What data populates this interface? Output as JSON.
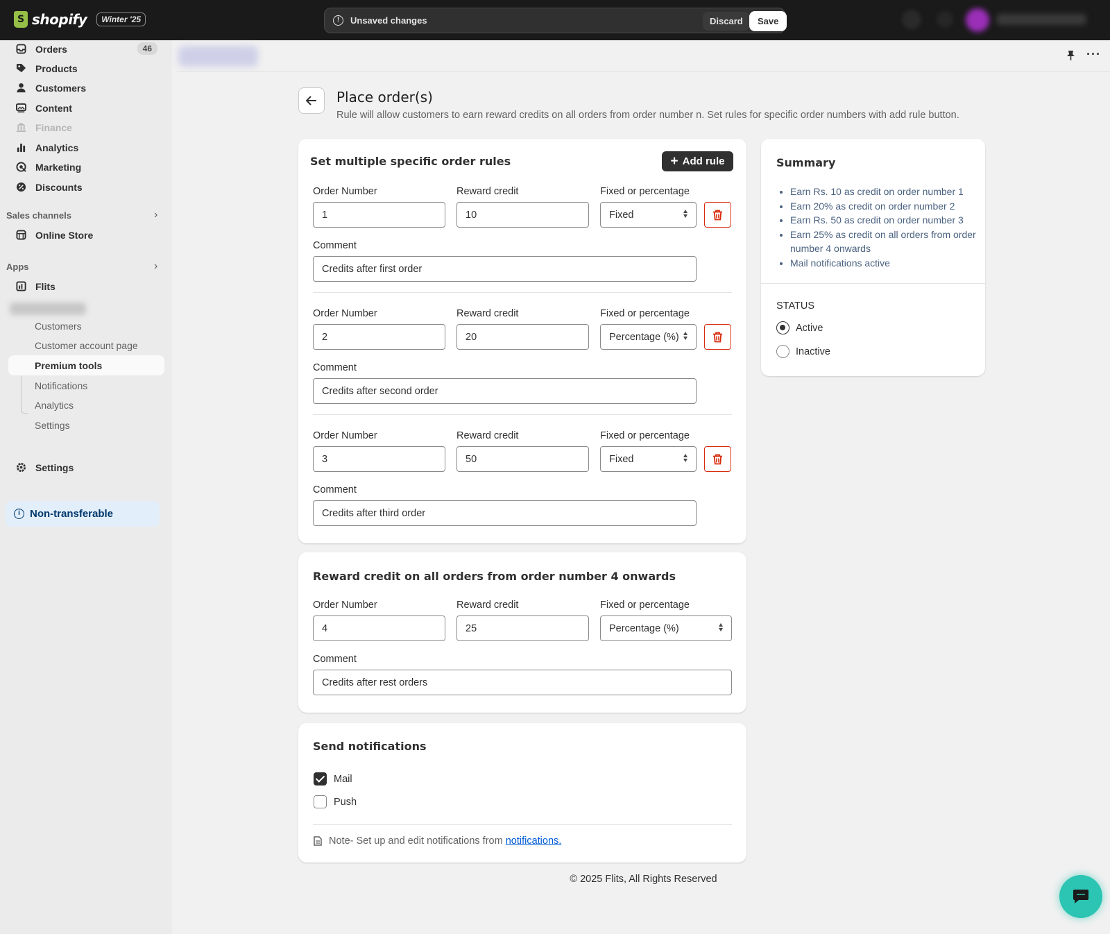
{
  "topbar": {
    "brand": "shopify",
    "edition": "Winter '25",
    "unsaved_text": "Unsaved changes",
    "discard_label": "Discard",
    "save_label": "Save"
  },
  "sidebar": {
    "items": [
      {
        "label": "Orders",
        "count": "46"
      },
      {
        "label": "Products"
      },
      {
        "label": "Customers"
      },
      {
        "label": "Content"
      },
      {
        "label": "Finance"
      },
      {
        "label": "Analytics"
      },
      {
        "label": "Marketing"
      },
      {
        "label": "Discounts"
      }
    ],
    "sales_channels_label": "Sales channels",
    "online_store_label": "Online Store",
    "apps_label": "Apps",
    "flits_label": "Flits",
    "sub_items": [
      {
        "label": "Customers"
      },
      {
        "label": "Customer account page"
      },
      {
        "label": "Premium tools"
      },
      {
        "label": "Notifications"
      },
      {
        "label": "Analytics"
      },
      {
        "label": "Settings"
      }
    ],
    "settings_label": "Settings",
    "non_transferable_label": "Non-transferable"
  },
  "page": {
    "title": "Place order(s)",
    "subtitle": "Rule will allow customers to earn reward credits on all orders from order number n. Set rules for specific order numbers with add rule button."
  },
  "rules_card": {
    "title": "Set multiple specific order rules",
    "add_rule_label": "Add rule",
    "order_number_label": "Order Number",
    "reward_credit_label": "Reward credit",
    "type_label": "Fixed or percentage",
    "comment_label": "Comment",
    "rules": [
      {
        "order_number": "1",
        "reward_credit": "10",
        "type": "Fixed",
        "comment": "Credits after first order"
      },
      {
        "order_number": "2",
        "reward_credit": "20",
        "type": "Percentage (%)",
        "comment": "Credits after second order"
      },
      {
        "order_number": "3",
        "reward_credit": "50",
        "type": "Fixed",
        "comment": "Credits after third order"
      }
    ]
  },
  "onwards_card": {
    "title": "Reward credit on all orders from order number 4 onwards",
    "order_number_label": "Order Number",
    "reward_credit_label": "Reward credit",
    "type_label": "Fixed or percentage",
    "comment_label": "Comment",
    "order_number": "4",
    "reward_credit": "25",
    "type": "Percentage (%)",
    "comment": "Credits after rest orders"
  },
  "notifications_card": {
    "title": "Send notifications",
    "mail_label": "Mail",
    "push_label": "Push",
    "note_text": "Note- Set up and edit notifications from",
    "note_link": "notifications."
  },
  "summary_card": {
    "title": "Summary",
    "items": [
      "Earn Rs. 10 as credit on order number 1",
      "Earn 20% as credit on order number 2",
      "Earn Rs. 50 as credit on order number 3",
      "Earn 25% as credit on all orders from order number 4 onwards",
      "Mail notifications active"
    ],
    "status_label": "STATUS",
    "active_label": "Active",
    "inactive_label": "Inactive"
  },
  "footer": {
    "text": "© 2025 Flits, All Rights Reserved"
  },
  "colors": {
    "accent_dark": "#303030",
    "danger": "#d72c0d",
    "link": "#005bd3",
    "chat": "#2cc4b3"
  }
}
